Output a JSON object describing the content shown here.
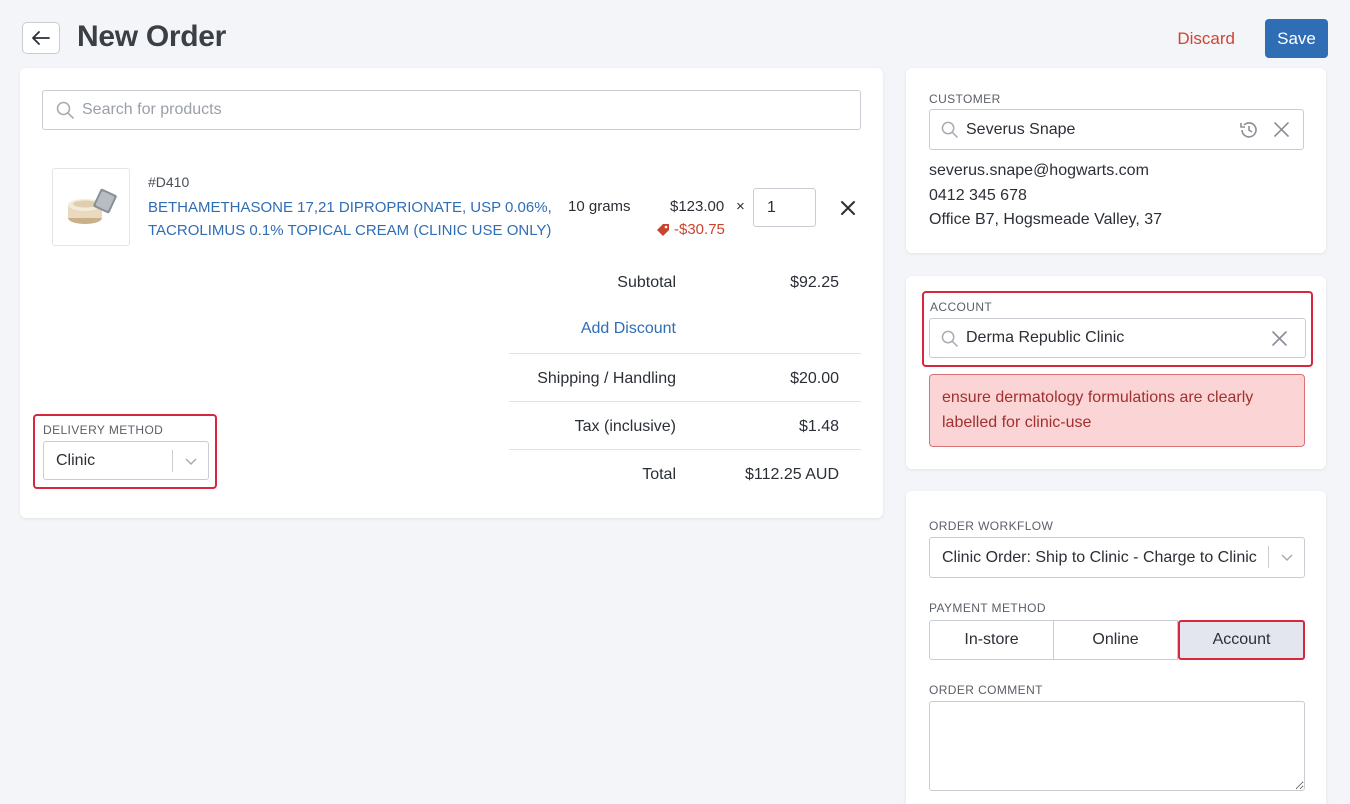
{
  "header": {
    "title": "New Order",
    "discard_label": "Discard",
    "save_label": "Save"
  },
  "search": {
    "placeholder": "Search for products"
  },
  "line_item": {
    "sku": "#D410",
    "name_line1": "BETHAMETHASONE 17,21 DIPROPRIONATE, USP 0.06%,",
    "name_line2": "TACROLIMUS 0.1% TOPICAL CREAM (CLINIC USE ONLY)",
    "variant": "10 grams",
    "price": "$123.00",
    "times": "×",
    "discount": "-$30.75",
    "quantity": "1"
  },
  "totals": {
    "subtotal_label": "Subtotal",
    "subtotal_value": "$92.25",
    "add_discount_label": "Add Discount",
    "shipping_label": "Shipping / Handling",
    "shipping_value": "$20.00",
    "tax_label": "Tax (inclusive)",
    "tax_value": "$1.48",
    "total_label": "Total",
    "total_value": "$112.25 AUD"
  },
  "delivery": {
    "label": "DELIVERY METHOD",
    "value": "Clinic"
  },
  "customer": {
    "label": "CUSTOMER",
    "name": "Severus Snape",
    "email": "severus.snape@hogwarts.com",
    "phone": "0412 345 678",
    "address": "Office B7, Hogsmeade Valley, 37"
  },
  "account": {
    "label": "ACCOUNT",
    "name": "Derma Republic Clinic",
    "alert_line1": "ensure dermatology formulations are clearly",
    "alert_line2": "labelled for clinic-use"
  },
  "workflow": {
    "label": "ORDER WORKFLOW",
    "value": "Clinic Order: Ship to Clinic - Charge to Clinic"
  },
  "payment": {
    "label": "PAYMENT METHOD",
    "options": [
      "In-store",
      "Online",
      "Account"
    ],
    "selected": "Account"
  },
  "comment": {
    "label": "ORDER COMMENT",
    "value": ""
  },
  "colors": {
    "accent": "#2f6db5",
    "danger": "#d04531",
    "highlight_border": "#d7263d",
    "alert_bg": "#fbd5d5"
  }
}
